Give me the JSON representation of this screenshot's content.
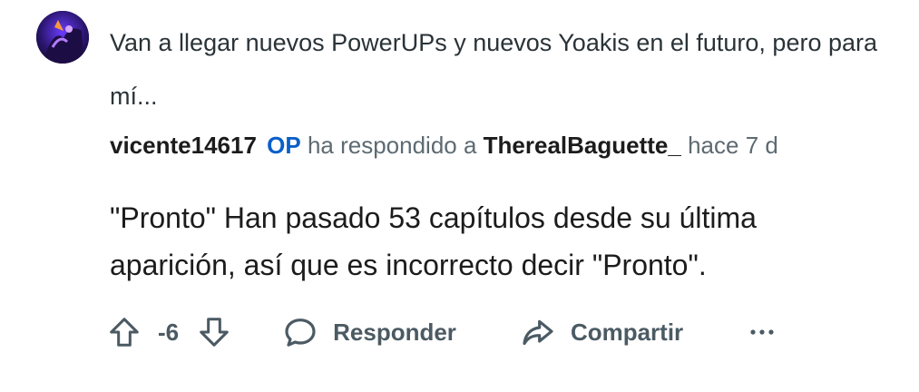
{
  "parent_comment": {
    "text": "Van a llegar nuevos PowerUPs y nuevos Yoakis en el futuro, pero para mí..."
  },
  "reply": {
    "author": "vicente14617",
    "op_badge": "OP",
    "reply_prefix": "ha respondido a",
    "reply_target": "TherealBaguette_",
    "timestamp": "hace 7 d",
    "body": "\"Pronto\" Han pasado 53 capítulos desde su última aparición, así que es incorrecto decir \"Pronto\"."
  },
  "actions": {
    "score": "-6",
    "reply_label": "Responder",
    "share_label": "Compartir"
  },
  "colors": {
    "op_badge": "#0a5fc9",
    "muted_text": "#5d6a72",
    "action_text": "#4b5a63"
  }
}
